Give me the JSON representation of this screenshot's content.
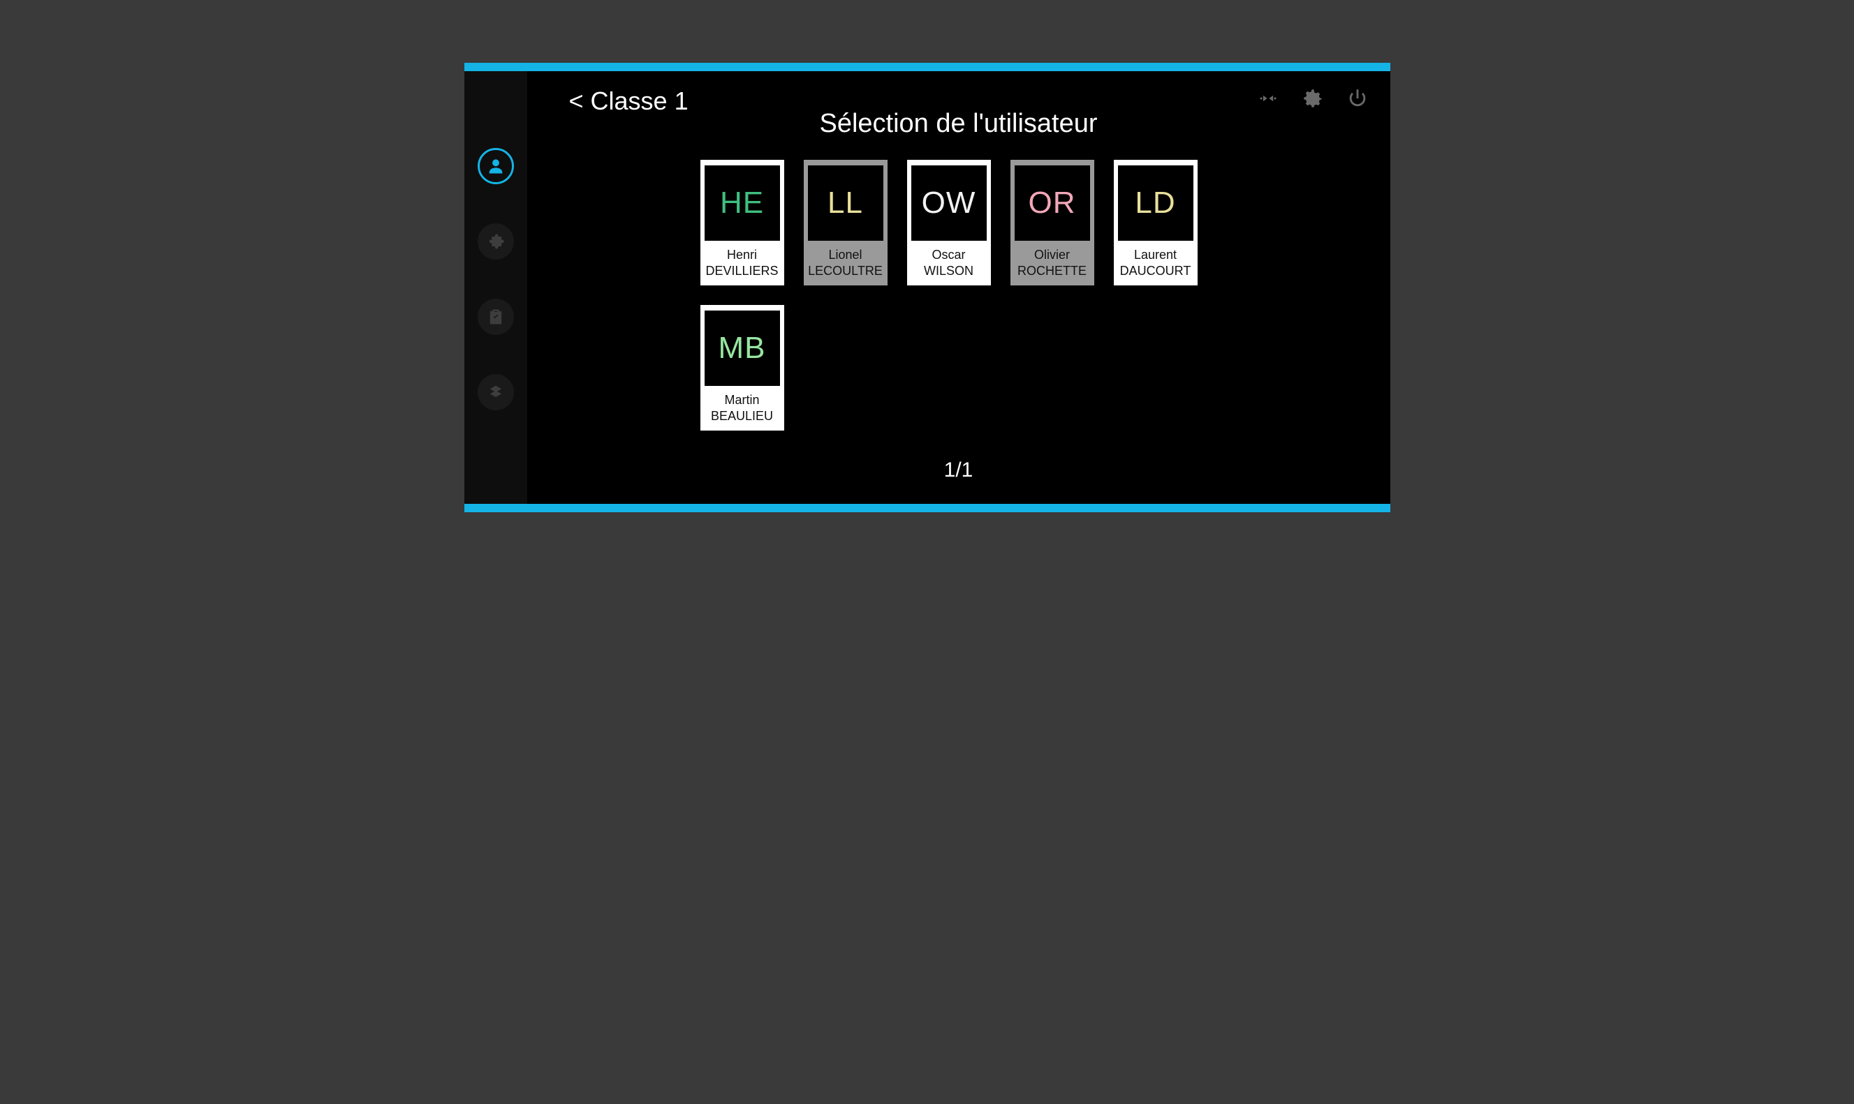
{
  "colors": {
    "accent": "#14b4e6",
    "bg_outer": "#3a3a3a",
    "bg_device": "#000000",
    "icon_inactive": "#6a6a6a"
  },
  "header": {
    "back_label": "< Classe 1",
    "title": "Sélection de l'utilisateur"
  },
  "pager": "1/1",
  "users": [
    {
      "initials": "HE",
      "color": "#3fbf7f",
      "first": "Henri",
      "last": "DEVILLIERS",
      "dim": false
    },
    {
      "initials": "LL",
      "color": "#e8e09a",
      "first": "Lionel",
      "last": "LECOULTRE",
      "dim": true
    },
    {
      "initials": "OW",
      "color": "#f2f2f2",
      "first": "Oscar",
      "last": "WILSON",
      "dim": false
    },
    {
      "initials": "OR",
      "color": "#f2a7b8",
      "first": "Olivier",
      "last": "ROCHETTE",
      "dim": true
    },
    {
      "initials": "LD",
      "color": "#e8e09a",
      "first": "Laurent",
      "last": "DAUCOURT",
      "dim": false
    },
    {
      "initials": "MB",
      "color": "#97e6a0",
      "first": "Martin",
      "last": "BEAULIEU",
      "dim": false
    }
  ],
  "sidebar": {
    "items": [
      {
        "name": "user-icon",
        "active": true
      },
      {
        "name": "puzzle-icon",
        "active": false
      },
      {
        "name": "clipboard-icon",
        "active": false
      },
      {
        "name": "rank-icon",
        "active": false
      }
    ]
  },
  "top_icons": [
    {
      "name": "plug-icon"
    },
    {
      "name": "gear-icon"
    },
    {
      "name": "power-icon"
    }
  ]
}
